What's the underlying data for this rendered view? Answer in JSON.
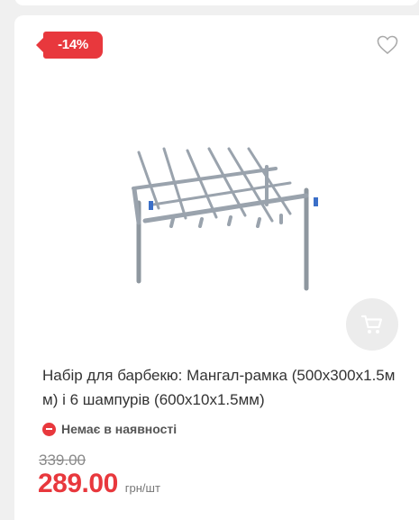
{
  "product": {
    "discount_badge": "-14%",
    "title": "Набір для барбекю: Мангал-рамка (500х300х1.5мм) і 6 шампурів (600х10х1.5мм)",
    "availability": "Немає в наявності",
    "old_price": "339.00",
    "price": "289.00",
    "unit": "грн/шт",
    "icons": {
      "wishlist": "heart-icon",
      "cart": "cart-icon",
      "availability": "minus-circle-icon"
    }
  },
  "colors": {
    "accent": "#e8383d",
    "text": "#333333",
    "muted": "#8a8a8a",
    "cart_button_bg": "#ececec"
  }
}
